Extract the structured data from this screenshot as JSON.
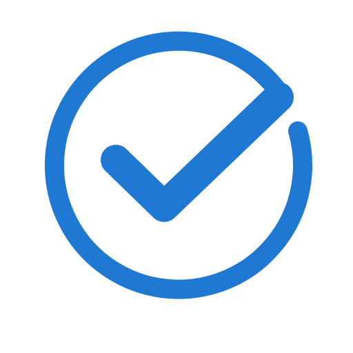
{
  "icon": {
    "name": "check-circle-icon",
    "color": "#1f78d1",
    "background": "#ffffff"
  }
}
